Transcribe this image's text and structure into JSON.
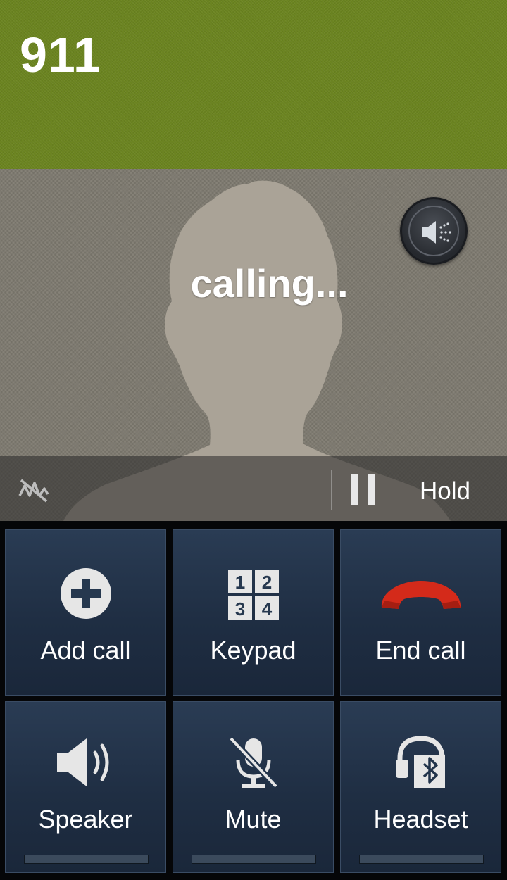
{
  "call": {
    "number": "911",
    "status": "calling...",
    "hold_label": "Hold"
  },
  "buttons": {
    "add_call": "Add call",
    "keypad": "Keypad",
    "end_call": "End call",
    "speaker": "Speaker",
    "mute": "Mute",
    "headset": "Headset"
  },
  "keypad_icon_digits": [
    "1",
    "2",
    "3",
    "4"
  ],
  "icons": {
    "volume": "speaker-volume-icon",
    "signal": "signal-off-icon",
    "pause": "pause-icon",
    "add": "plus-circle-icon",
    "keypad": "keypad-icon",
    "end": "phone-hangup-icon",
    "speaker": "speaker-icon",
    "mute": "microphone-off-icon",
    "headset": "bluetooth-headset-icon"
  },
  "colors": {
    "top_bar": "#6b8420",
    "caller_bg": "#7e7a70",
    "button_bg": "#22344b",
    "end_call_red": "#d42a1a"
  }
}
